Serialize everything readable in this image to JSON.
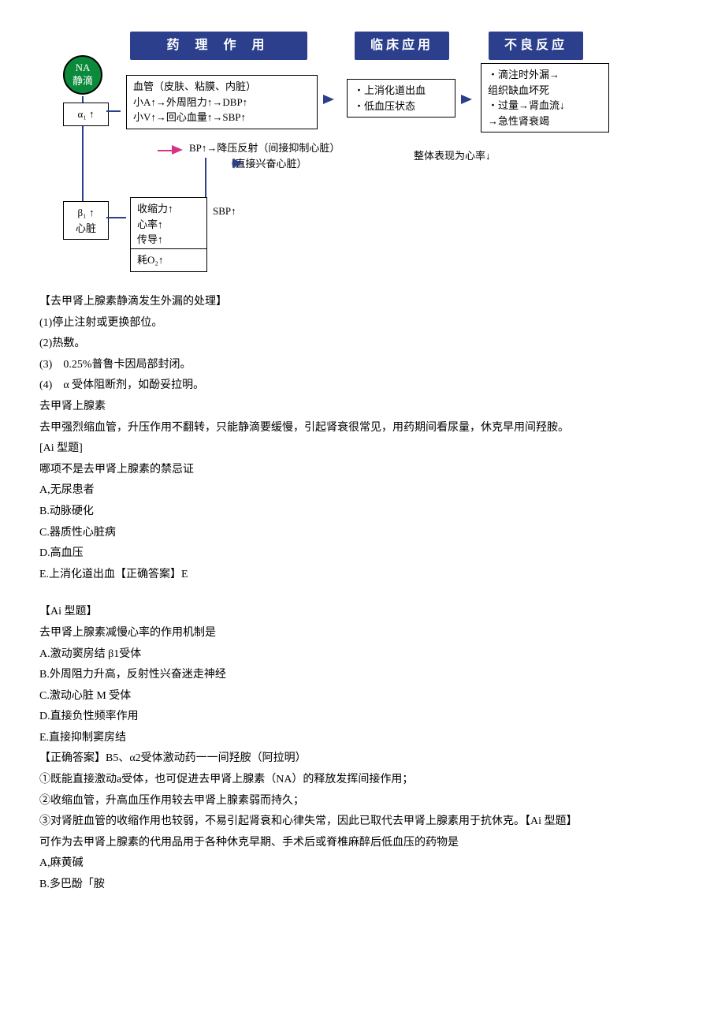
{
  "diagram": {
    "hdr1": "药 理 作 用",
    "hdr2": "临床应用",
    "hdr3": "不良反应",
    "circle": "NA\n静滴",
    "alpha_box": "α₁ ↑",
    "vessel_box": "血管（皮肤、粘膜、内脏）\n小A↑→外周阻力↑→DBP↑\n小V↑→回心血量↑→SBP↑",
    "clinical_box": "・上消化道出血\n・低血压状态",
    "adverse_box": "・滴注时外漏→\n  组织缺血坏死\n・过量→肾血流↓\n  →急性肾衰竭",
    "bp_text": "BP↑→降压反射（间接抑制心脏）\n　　　　（直接兴奋心脏）",
    "bp_result": "整体表现为心率↓",
    "beta_box": "β₁ ↑\n心脏",
    "heart_box1": "收缩力↑\n心率↑\n传导↑",
    "heart_sbp": "SBP↑",
    "heart_box2": "耗O₂↑"
  },
  "paras": {
    "p1": "【去甲肾上腺素静滴发生外漏的处理】",
    "p2": "(1)停止注射或更换部位。",
    "p3": "(2)热敷。",
    "p4": "(3)　0.25%普鲁卡因局部封闭。",
    "p5": "(4)　α 受体阻断剂，如酚妥拉明。",
    "p6": "去甲肾上腺素",
    "p7": "去甲强烈缩血管，升压作用不翻转，只能静滴要缓慢，引起肾衰很常见，用药期间看尿量，休克早用间羟胺。",
    "p8": "[Ai 型题]",
    "p9": "哪项不是去甲肾上腺素的禁忌证",
    "p10": "A,无尿患者",
    "p11": "B.动脉硬化",
    "p12": "C.器质性心脏病",
    "p13": "D.高血压",
    "p14": "E.上消化道出血【正确答案】E",
    "p15": "",
    "p16": "【Ai 型题】",
    "p17": "去甲肾上腺素减慢心率的作用机制是",
    "p18": "Α.激动窦房结 β1受体",
    "p19": "B.外周阻力升高，反射性兴奋迷走神经",
    "p20": "C.激动心脏 M 受体",
    "p21": "D.直接负性频率作用",
    "p22": "E.直接抑制窦房结",
    "p23": "【正确答案】B5、α2受体激动药一一间羟胺（阿拉明）",
    "p24": "①既能直接激动a受体，也可促进去甲肾上腺素（NA）的释放发挥间接作用；",
    "p25": "②收缩血管，升高血压作用较去甲肾上腺素弱而持久；",
    "p26": "③对肾脏血管的收缩作用也较弱，不易引起肾衰和心律失常，因此已取代去甲肾上腺素用于抗休克。【Ai 型题】",
    "p27": "可作为去甲肾上腺素的代用品用于各种休克早期、手术后或脊椎麻醉后低血压的药物是",
    "p28": "A,麻黄碱",
    "p29": "B.多巴酚「胺"
  }
}
